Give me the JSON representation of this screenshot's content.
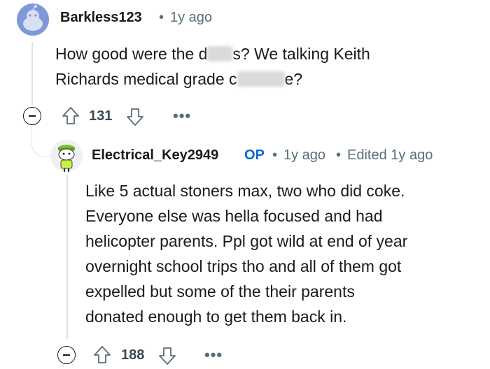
{
  "comment1": {
    "username": "Barkless123",
    "separator": "•",
    "time": "1y ago",
    "line1_a": "How good were the d",
    "line1_b": "s? We talking Keith",
    "line2_a": "Richards medical grade c",
    "line2_b": "e?",
    "votes": "131",
    "more": "•••"
  },
  "comment2": {
    "username": "Electrical_Key2949",
    "op_badge": "OP",
    "separator": "•",
    "time": "1y ago",
    "separator2": "•",
    "edited": "Edited 1y ago",
    "lines": [
      "Like 5 actual stoners max, two who did coke.",
      "Everyone else was hella focused and had",
      "helicopter parents. Ppl got wild at end of year",
      "overnight school trips tho and all of them got",
      "expelled but some of the their parents",
      "donated enough to get them back in."
    ],
    "votes": "188",
    "more": "•••"
  }
}
